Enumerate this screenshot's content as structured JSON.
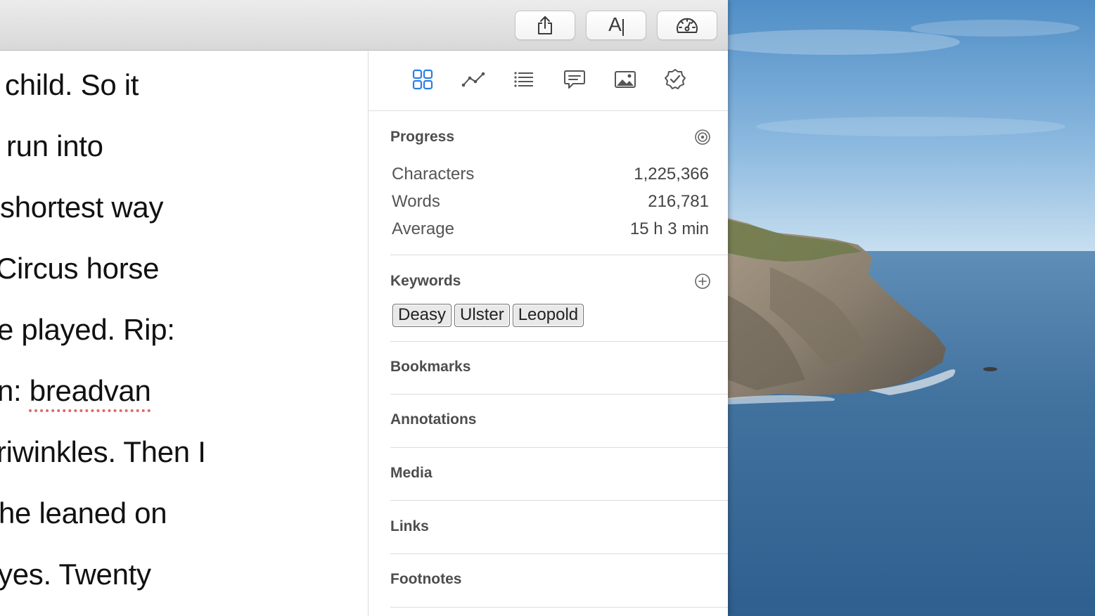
{
  "toolbar": {
    "share_icon": "share-icon",
    "font_icon": "font-icon",
    "font_label": "A",
    "dashboard_icon": "speedometer-icon"
  },
  "editor": {
    "lines": [
      "child. So it",
      "run into",
      "shortest way",
      "Circus horse",
      "e played. Rip:",
      "n: ",
      "riwinkles. Then I",
      "he leaned on",
      "yes. Twenty"
    ],
    "misspelled_word": "breadvan",
    "text_color": "#111111",
    "spellcheck_color": "#e06868"
  },
  "sidebar": {
    "tabs": [
      {
        "icon": "grid-icon",
        "selected": true
      },
      {
        "icon": "graph-icon",
        "selected": false
      },
      {
        "icon": "list-icon",
        "selected": false
      },
      {
        "icon": "comment-icon",
        "selected": false
      },
      {
        "icon": "image-icon",
        "selected": false
      },
      {
        "icon": "checkmark-badge-icon",
        "selected": false
      }
    ],
    "accent_color": "#2b7de9",
    "progress": {
      "title": "Progress",
      "icon": "target-icon",
      "stats": [
        {
          "label": "Characters",
          "value": "1,225,366"
        },
        {
          "label": "Words",
          "value": "216,781"
        },
        {
          "label": "Average",
          "value": "15 h 3 min"
        }
      ]
    },
    "keywords": {
      "title": "Keywords",
      "icon": "add-circle-icon",
      "items": [
        "Deasy",
        "Ulster",
        "Leopold"
      ]
    },
    "sections": [
      {
        "title": "Bookmarks"
      },
      {
        "title": "Annotations"
      },
      {
        "title": "Media"
      },
      {
        "title": "Links"
      },
      {
        "title": "Footnotes"
      }
    ]
  }
}
